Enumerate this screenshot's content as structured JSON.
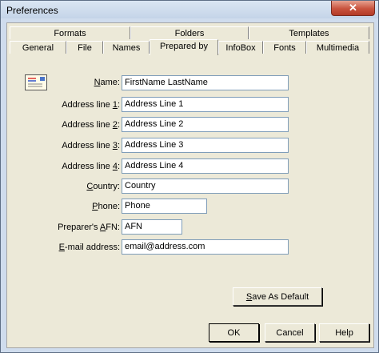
{
  "window": {
    "title": "Preferences",
    "close_glyph": "✕"
  },
  "tabs_back": [
    "Formats",
    "Folders",
    "Templates"
  ],
  "tabs_front": [
    "General",
    "File",
    "Names",
    "Prepared by",
    "InfoBox",
    "Fonts",
    "Multimedia"
  ],
  "active_tab": "Prepared by",
  "fields": [
    {
      "label_pre": "",
      "label_ul": "N",
      "label_post": "ame:",
      "value": "FirstName LastName"
    },
    {
      "label_pre": "Address line ",
      "label_ul": "1",
      "label_post": ":",
      "value": "Address Line 1"
    },
    {
      "label_pre": "Address line ",
      "label_ul": "2",
      "label_post": ":",
      "value": "Address Line 2"
    },
    {
      "label_pre": "Address line ",
      "label_ul": "3",
      "label_post": ":",
      "value": "Address Line 3"
    },
    {
      "label_pre": "Address line ",
      "label_ul": "4",
      "label_post": ":",
      "value": "Address Line 4"
    },
    {
      "label_pre": "",
      "label_ul": "C",
      "label_post": "ountry:",
      "value": "Country"
    },
    {
      "label_pre": "",
      "label_ul": "P",
      "label_post": "hone:",
      "value": "Phone"
    },
    {
      "label_pre": "Preparer's ",
      "label_ul": "A",
      "label_post": "FN:",
      "value": "AFN"
    },
    {
      "label_pre": "",
      "label_ul": "E",
      "label_post": "-mail address:",
      "value": "email@address.com"
    }
  ],
  "buttons": {
    "save_default_ul": "S",
    "save_default_rest": "ave As Default",
    "ok": "OK",
    "cancel": "Cancel",
    "help": "Help"
  },
  "icons": {
    "envelope": "envelope-icon"
  }
}
